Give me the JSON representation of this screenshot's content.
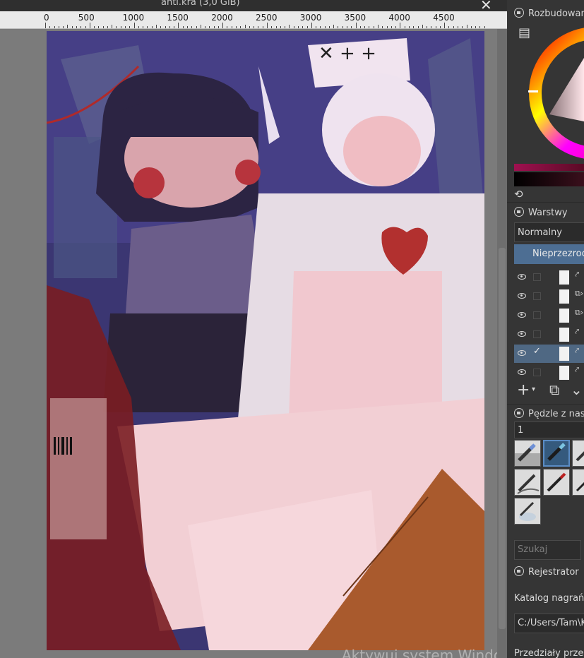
{
  "window": {
    "doc_title": "anti.kra (3,0 GiB)",
    "close_symbol": "✕"
  },
  "ruler": {
    "labels": [
      "0",
      "500",
      "1000",
      "1500",
      "2000",
      "2500",
      "3000",
      "3500",
      "4000",
      "4500"
    ]
  },
  "watermark": "Aktywuj system Windows",
  "dock": {
    "color_panel_title": "Rozbudowany selektor kolorów",
    "layers": {
      "title": "Warstwy",
      "blend_mode": "Normalny",
      "opacity_label": "Nieprzezroczystość",
      "rows": [
        {
          "visible": true,
          "checked": false,
          "selected": false,
          "extra": "⤤"
        },
        {
          "visible": true,
          "checked": false,
          "selected": false,
          "extra": "⧉›"
        },
        {
          "visible": true,
          "checked": false,
          "selected": false,
          "extra": "⧉›"
        },
        {
          "visible": true,
          "checked": false,
          "selected": false,
          "extra": "⤤"
        },
        {
          "visible": true,
          "checked": true,
          "selected": true,
          "extra": "⤤"
        },
        {
          "visible": true,
          "checked": false,
          "selected": false,
          "extra": "⤤"
        }
      ]
    },
    "brushes": {
      "title": "Pędzle z nastawami",
      "tag_value": "1",
      "search_placeholder": "Szukaj"
    },
    "recorder": {
      "title": "Rejestrator",
      "directory_label": "Katalog nagrań:",
      "directory_value": "C:/Users/Tam\\K",
      "intervals_label": "Przedziały przechwytywania"
    }
  },
  "colors": {
    "accent": "#4d6e93",
    "panel": "#353535",
    "canvas_bg": "#7b7b7b"
  }
}
